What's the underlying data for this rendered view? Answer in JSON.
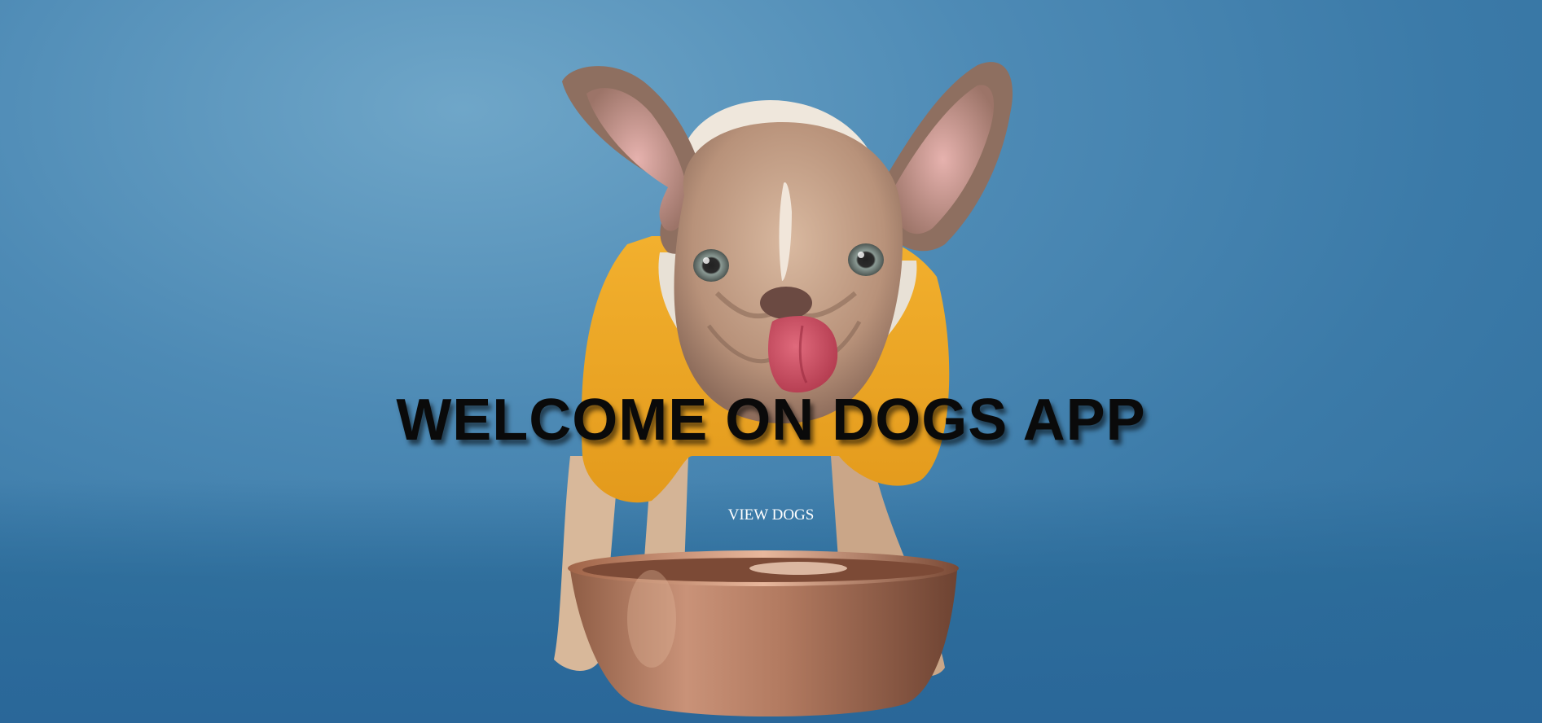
{
  "hero": {
    "image_alt": "French bulldog in a yellow hoodie licking its nose behind a copper food bowl",
    "title": "WELCOME ON DOGS APP",
    "button_label": "VIEW DOGS"
  },
  "colors": {
    "background": "#3b7aa8",
    "title_text": "#0a0a0a",
    "button_text": "#ffffff"
  }
}
